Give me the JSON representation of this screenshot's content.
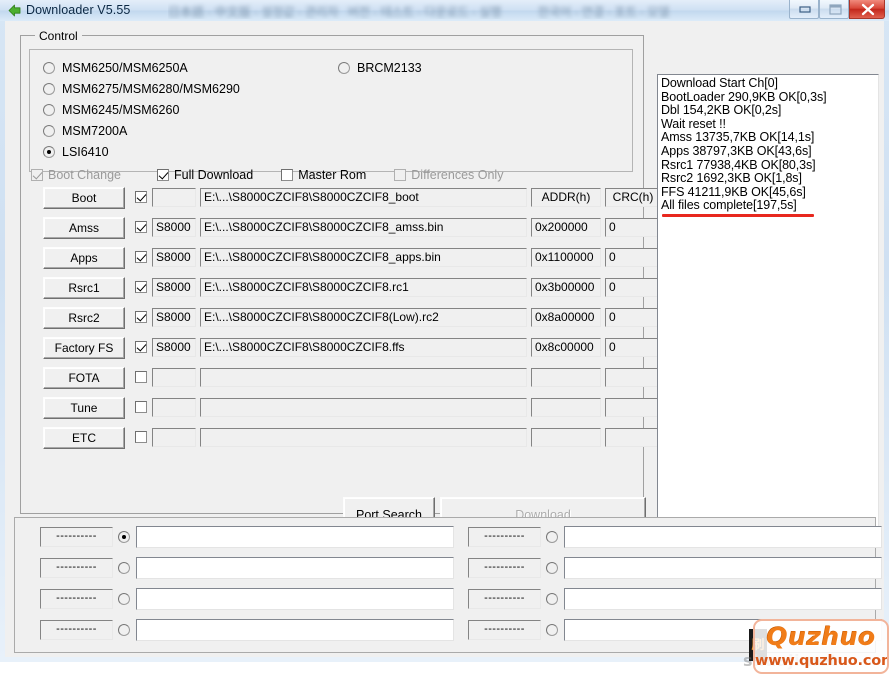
{
  "window": {
    "title": "Downloader V5.55",
    "title_icon": "back-arrow-icon",
    "obscured_title_text": "blurred text",
    "buttons": {
      "minimize": "minimize-icon",
      "maximize": "maximize-icon",
      "close": "X"
    }
  },
  "control": {
    "legend": "Control",
    "chipsets_left": [
      {
        "label": "MSM6250/MSM6250A",
        "selected": false
      },
      {
        "label": "MSM6275/MSM6280/MSM6290",
        "selected": false
      },
      {
        "label": "MSM6245/MSM6260",
        "selected": false
      },
      {
        "label": "MSM7200A",
        "selected": false
      },
      {
        "label": "LSI6410",
        "selected": true
      }
    ],
    "chipsets_right": [
      {
        "label": "BRCM2133",
        "selected": false
      }
    ],
    "options": [
      {
        "label": "Boot Change",
        "checked": true,
        "enabled": false
      },
      {
        "label": "Full Download",
        "checked": true,
        "enabled": true
      },
      {
        "label": "Master Rom",
        "checked": false,
        "enabled": true
      },
      {
        "label": "Differences Only",
        "checked": false,
        "enabled": false
      }
    ],
    "columns": {
      "addr": "ADDR(h)",
      "crc": "CRC(h)"
    },
    "rows": [
      {
        "button": "Boot",
        "checked": true,
        "tag": "",
        "path": "E:\\...\\S8000CZCIF8\\S8000CZCIF8_boot",
        "addr": "ADDR(h)",
        "crc": "CRC(h)",
        "is_header_row": true
      },
      {
        "button": "Amss",
        "checked": true,
        "tag": "S8000",
        "path": "E:\\...\\S8000CZCIF8\\S8000CZCIF8_amss.bin",
        "addr": "0x200000",
        "crc": "0"
      },
      {
        "button": "Apps",
        "checked": true,
        "tag": "S8000",
        "path": "E:\\...\\S8000CZCIF8\\S8000CZCIF8_apps.bin",
        "addr": "0x1100000",
        "crc": "0"
      },
      {
        "button": "Rsrc1",
        "checked": true,
        "tag": "S8000",
        "path": "E:\\...\\S8000CZCIF8\\S8000CZCIF8.rc1",
        "addr": "0x3b00000",
        "crc": "0"
      },
      {
        "button": "Rsrc2",
        "checked": true,
        "tag": "S8000",
        "path": "E:\\...\\S8000CZCIF8\\S8000CZCIF8(Low).rc2",
        "addr": "0x8a00000",
        "crc": "0"
      },
      {
        "button": "Factory FS",
        "checked": true,
        "tag": "S8000",
        "path": "E:\\...\\S8000CZCIF8\\S8000CZCIF8.ffs",
        "addr": "0x8c00000",
        "crc": "0"
      },
      {
        "button": "FOTA",
        "checked": false,
        "tag": "",
        "path": "",
        "addr": "",
        "crc": ""
      },
      {
        "button": "Tune",
        "checked": false,
        "tag": "",
        "path": "",
        "addr": "",
        "crc": ""
      },
      {
        "button": "ETC",
        "checked": false,
        "tag": "",
        "path": "",
        "addr": "",
        "crc": ""
      }
    ],
    "actions": {
      "port_search": "Port Search",
      "download": "Download",
      "download_enabled": false
    }
  },
  "log": {
    "lines": [
      "Download Start Ch[0]",
      "BootLoader 290,9KB OK[0,3s]",
      "Dbl 154,2KB OK[0,2s]",
      "Wait reset !!",
      "Amss 13735,7KB OK[14,1s]",
      "Apps 38797,3KB OK[43,6s]",
      "Rsrc1 77938,4KB OK[80,3s]",
      "Rsrc2 1692,3KB OK[1,8s]",
      "FFS 41211,9KB OK[45,6s]",
      "All files complete[197,5s]"
    ],
    "text": "Download Start Ch[0]\nBootLoader 290,9KB OK[0,3s]\nDbl 154,2KB OK[0,2s]\nWait reset !!\nAmss 13735,7KB OK[14,1s]\nApps 38797,3KB OK[43,6s]\nRsrc1 77938,4KB OK[80,3s]\nRsrc2 1692,3KB OK[1,8s]\nFFS 41211,9KB OK[45,6s]\nAll files complete[197,5s]",
    "highlight_color": "#e8281e"
  },
  "ports": {
    "left": [
      {
        "name": "----------",
        "selected": true,
        "value": ""
      },
      {
        "name": "----------",
        "selected": false,
        "value": ""
      },
      {
        "name": "----------",
        "selected": false,
        "value": ""
      },
      {
        "name": "----------",
        "selected": false,
        "value": ""
      }
    ],
    "right": [
      {
        "name": "----------",
        "selected": false,
        "value": ""
      },
      {
        "name": "----------",
        "selected": false,
        "value": ""
      },
      {
        "name": "----------",
        "selected": false,
        "value": ""
      },
      {
        "name": "----------",
        "selected": false,
        "value": ""
      }
    ]
  },
  "watermark": {
    "brand": "Quzhuo",
    "url": "www.quzhuo.com",
    "ghost": "shuaji.net",
    "badge": "刷",
    "color": "#f07c18"
  }
}
